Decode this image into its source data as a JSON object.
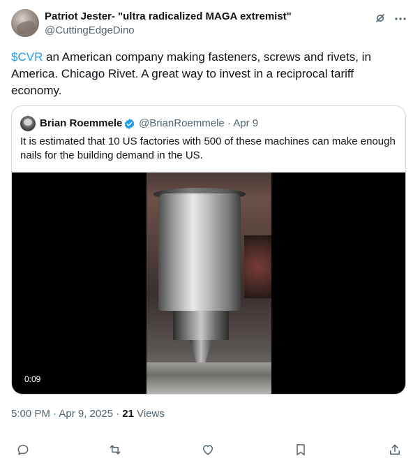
{
  "author": {
    "name": "Patriot Jester- \"ultra radicalized MAGA extremist\"",
    "handle": "@CuttingEdgeDino"
  },
  "tweet": {
    "cashtag": "$CVR",
    "text_line1": "  an American company making fasteners, screws and rivets, in",
    "text_line2": "America.   Chicago Rivet.  A great way to invest in a reciprocal tariff",
    "text_line3": "economy."
  },
  "quote": {
    "name": "Brian Roemmele",
    "meta": "@BrianRoemmele · Apr 9",
    "text_line1": "It is estimated that 10 US factories with 500 of these machines can make enough",
    "text_line2": "nails for the building demand in the US.",
    "video_duration": "0:09"
  },
  "meta": {
    "time_date": "5:00 PM · Apr 9, 2025 · ",
    "views_count": "21",
    "views_label": " Views"
  },
  "icons": {
    "grok": "grok-icon",
    "more": "more-icon",
    "verified": "verified-badge-icon",
    "reply": "reply-icon",
    "retweet": "retweet-icon",
    "like": "like-icon",
    "bookmark": "bookmark-icon",
    "share": "share-icon"
  },
  "colors": {
    "accent": "#1d9bf0",
    "secondary_text": "#536471",
    "border": "#cfd9de"
  }
}
